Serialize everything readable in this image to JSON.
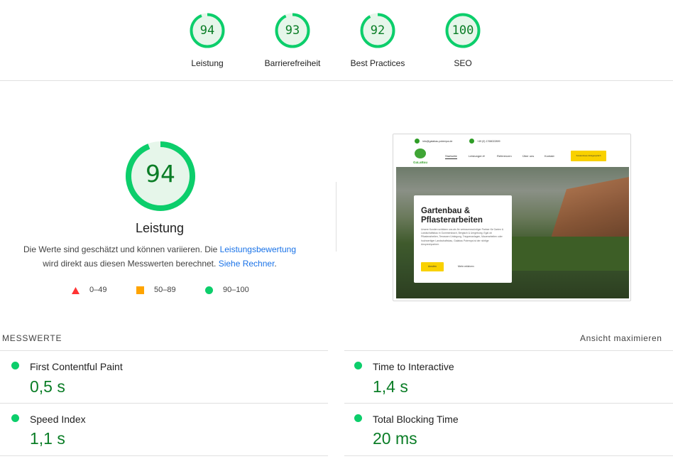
{
  "summary_gauges": [
    {
      "score": "94",
      "label": "Leistung",
      "fraction": 0.94
    },
    {
      "score": "93",
      "label": "Barrierefreiheit",
      "fraction": 0.93
    },
    {
      "score": "92",
      "label": "Best Practices",
      "fraction": 0.92
    },
    {
      "score": "100",
      "label": "SEO",
      "fraction": 1.0
    }
  ],
  "performance": {
    "score": "94",
    "fraction": 0.94,
    "title": "Leistung",
    "desc_part1": "Die Werte sind geschätzt und können variieren. Die ",
    "desc_link1": "Leistungsbewertung",
    "desc_part2": "wird direkt aus diesen Messwerten berechnet. ",
    "desc_link2": "Siehe Rechner",
    "desc_end": "."
  },
  "legend": [
    {
      "range": "0–49",
      "shape": "triangle",
      "color": "#ff3333"
    },
    {
      "range": "50–89",
      "shape": "square",
      "color": "#ffa400"
    },
    {
      "range": "90–100",
      "shape": "circle",
      "color": "#0cce6b"
    }
  ],
  "screenshot": {
    "email": "info@galabau-potempa.de",
    "phone": "+49 (0) 1768022899",
    "logo_text": "GaLaBau",
    "nav": [
      "Startseite",
      "Leistungen ▾",
      "Referenzen",
      "Über uns",
      "Kontakt"
    ],
    "cta_button": "Kostenloses Erstgespräch",
    "hero_title_line1": "Gartenbau &",
    "hero_title_line2": "Pflasterarbeiten",
    "hero_text": "Unsere Kunden schätzen uns als Ihr vertrauenswürdiger Partner für Garten & Landschaftsbau in Gummersbach, Bergisch & Umgebung. Egal ob Pflasterarbeiten, Terrassen Umlegung, Treppenanlagen, Mauerarbeiten oder hochwertiger Landschaftsbau, Galabau Potempa ist der richtige Ansprechpartner.",
    "hero_button": "Anrufen",
    "hero_more": "Mehr erfahren"
  },
  "metrics_section": {
    "heading": "MESSWERTE",
    "expand_label": "Ansicht maximieren",
    "items": [
      {
        "label": "First Contentful Paint",
        "value": "0,5 s"
      },
      {
        "label": "Time to Interactive",
        "value": "1,4 s"
      },
      {
        "label": "Speed Index",
        "value": "1,1 s"
      },
      {
        "label": "Total Blocking Time",
        "value": "20 ms"
      }
    ]
  },
  "colors": {
    "pass_green": "#0cce6b",
    "pass_text": "#0a7d26",
    "pass_fill": "#e6f6ea",
    "link": "#1a73e8"
  }
}
